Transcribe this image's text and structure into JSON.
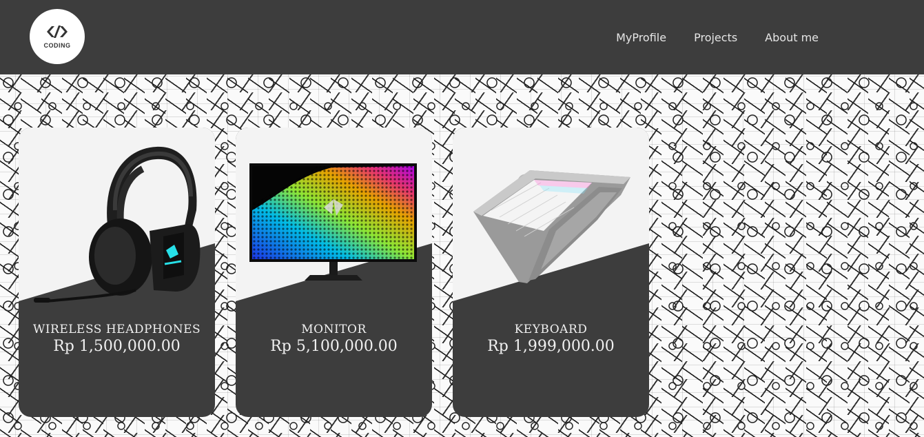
{
  "brand": {
    "logo_text": "CODING",
    "icon": "code-brackets-icon"
  },
  "nav": {
    "items": [
      {
        "label": "MyProfile"
      },
      {
        "label": "Projects"
      },
      {
        "label": "About me"
      }
    ]
  },
  "products": [
    {
      "name": "WIRELESS HEADPHONES",
      "price": "Rp 1,500,000.00",
      "image": "headphones-image"
    },
    {
      "name": "MONITOR",
      "price": "Rp 5,100,000.00",
      "image": "monitor-image"
    },
    {
      "name": "KEYBOARD",
      "price": "Rp 1,999,000.00",
      "image": "keyboard-image"
    }
  ],
  "colors": {
    "navbar": "#3d3d3d",
    "card_dark": "#3d3d3d",
    "card_light": "#f3f3f3",
    "text_light": "#f0f0f0"
  }
}
